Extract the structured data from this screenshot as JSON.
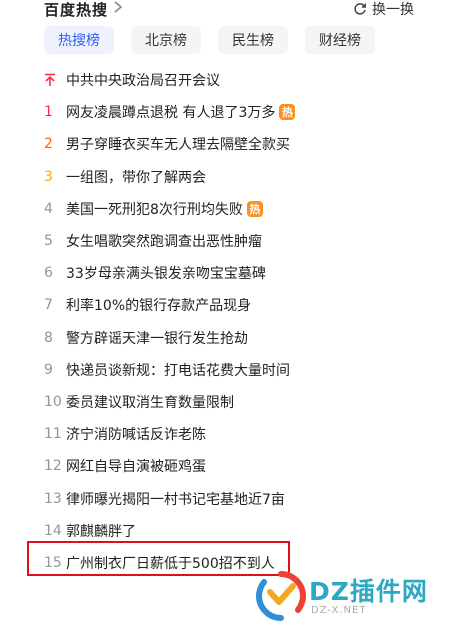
{
  "header": {
    "title": "百度热搜",
    "refresh_label": "换一换"
  },
  "tabs": [
    {
      "label": "热搜榜",
      "active": true
    },
    {
      "label": "北京榜",
      "active": false
    },
    {
      "label": "民生榜",
      "active": false
    },
    {
      "label": "财经榜",
      "active": false
    }
  ],
  "items": [
    {
      "rank": "",
      "pinned": true,
      "text": "中共中央政治局召开会议",
      "badge": ""
    },
    {
      "rank": "1",
      "text": "网友凌晨蹲点退税 有人退了3万多",
      "badge": "热"
    },
    {
      "rank": "2",
      "text": "男子穿睡衣买车无人理去隔壁全款买",
      "badge": ""
    },
    {
      "rank": "3",
      "text": "一组图，带你了解两会",
      "badge": ""
    },
    {
      "rank": "4",
      "text": "美国一死刑犯8次行刑均失败",
      "badge": "热"
    },
    {
      "rank": "5",
      "text": "女生唱歌突然跑调查出恶性肿瘤",
      "badge": ""
    },
    {
      "rank": "6",
      "text": "33岁母亲满头银发亲吻宝宝墓碑",
      "badge": ""
    },
    {
      "rank": "7",
      "text": "利率10%的银行存款产品现身",
      "badge": ""
    },
    {
      "rank": "8",
      "text": "警方辟谣天津一银行发生抢劫",
      "badge": ""
    },
    {
      "rank": "9",
      "text": "快递员谈新规：打电话花费大量时间",
      "badge": ""
    },
    {
      "rank": "10",
      "text": "委员建议取消生育数量限制",
      "badge": ""
    },
    {
      "rank": "11",
      "text": "济宁消防喊话反诈老陈",
      "badge": ""
    },
    {
      "rank": "12",
      "text": "网红自导自演被砸鸡蛋",
      "badge": ""
    },
    {
      "rank": "13",
      "text": "律师曝光揭阳一村书记宅基地近7亩",
      "badge": ""
    },
    {
      "rank": "14",
      "text": "郭麒麟胖了",
      "badge": ""
    },
    {
      "rank": "15",
      "text": "广州制衣厂日薪低于500招不到人",
      "badge": ""
    }
  ],
  "watermark": {
    "text": "DZ插件网",
    "sub": "DZ-X.NET"
  },
  "colors": {
    "accent": "#315efb",
    "rank1": "#fe2d46",
    "rank2": "#ff6600",
    "rank3": "#faa90e",
    "hot_badge": "#ff8f1f",
    "highlight_border": "#e0101a"
  }
}
